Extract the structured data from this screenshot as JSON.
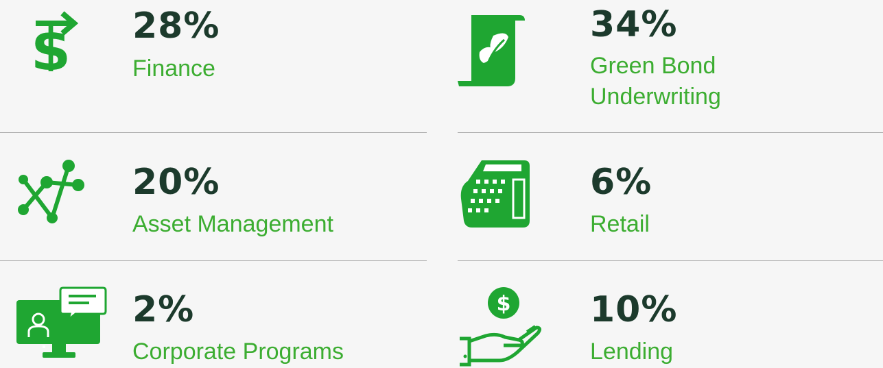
{
  "colors": {
    "value_text": "#1c3a2c",
    "label_text": "#3cad31",
    "icon_green": "#1fa632",
    "divider": "#a9a9a9",
    "background": "#f6f6f6"
  },
  "stats": [
    {
      "value": "28%",
      "label": "Finance",
      "icon": "dollar-sign-icon"
    },
    {
      "value": "34%",
      "label_line1": "Green Bond",
      "label_line2": "Underwriting",
      "icon": "leaf-scroll-icon"
    },
    {
      "value": "20%",
      "label": "Asset Management",
      "icon": "network-nodes-icon"
    },
    {
      "value": "6%",
      "label": "Retail",
      "icon": "cash-register-icon"
    },
    {
      "value": "2%",
      "label": "Corporate Programs",
      "icon": "monitor-chat-icon"
    },
    {
      "value": "10%",
      "label": "Lending",
      "icon": "hand-coin-icon"
    }
  ]
}
